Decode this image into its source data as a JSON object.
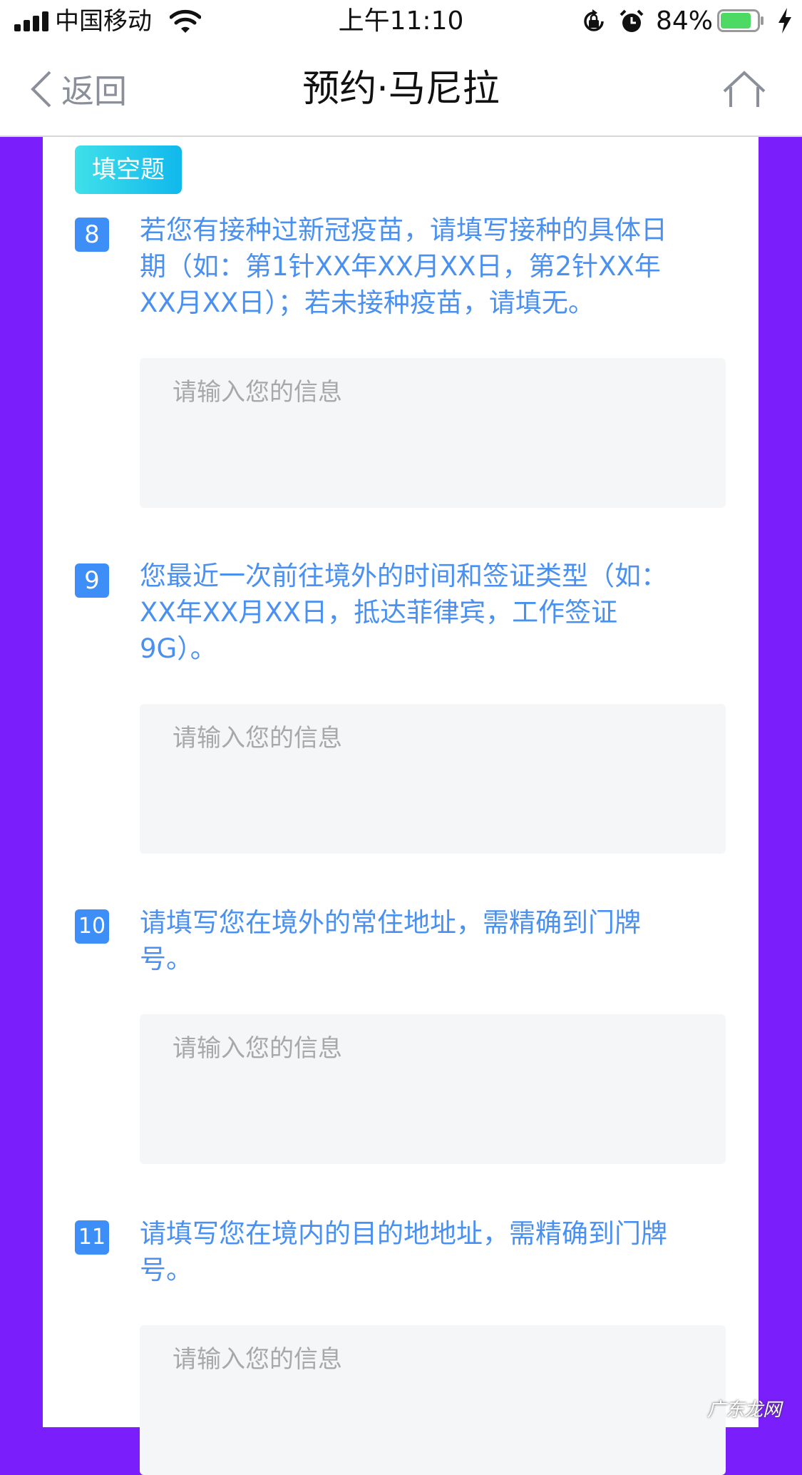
{
  "status_bar": {
    "carrier": "中国移动",
    "time": "上午11:10",
    "battery_percent": "84%",
    "battery_level": 0.84,
    "battery_color": "#4cd964"
  },
  "nav": {
    "back_label": "返回",
    "title": "预约·马尼拉",
    "home_icon": "home-icon"
  },
  "section_type": "填空题",
  "questions": [
    {
      "number": "8",
      "text": "若您有接种过新冠疫苗，请填写接种的具体日\n期（如：第1针XX年XX月XX日，第2针XX年\nXX月XX日）；若未接种疫苗，请填无。",
      "placeholder": "请输入您的信息"
    },
    {
      "number": "9",
      "text": "您最近一次前往境外的时间和签证类型（如：\nXX年XX月XX日，抵达菲律宾，工作签证\n9G）。",
      "placeholder": "请输入您的信息"
    },
    {
      "number": "10",
      "text": "请填写您在境外的常住地址，需精确到门牌\n号。",
      "placeholder": "请输入您的信息"
    },
    {
      "number": "11",
      "text": "请填写您在境内的目的地地址，需精确到门牌\n号。",
      "placeholder": "请输入您的信息"
    }
  ],
  "watermark": "广东龙网",
  "colors": {
    "background": "#7a1ffb",
    "accent": "#3d8ef7",
    "question_text": "#4a90f0"
  }
}
